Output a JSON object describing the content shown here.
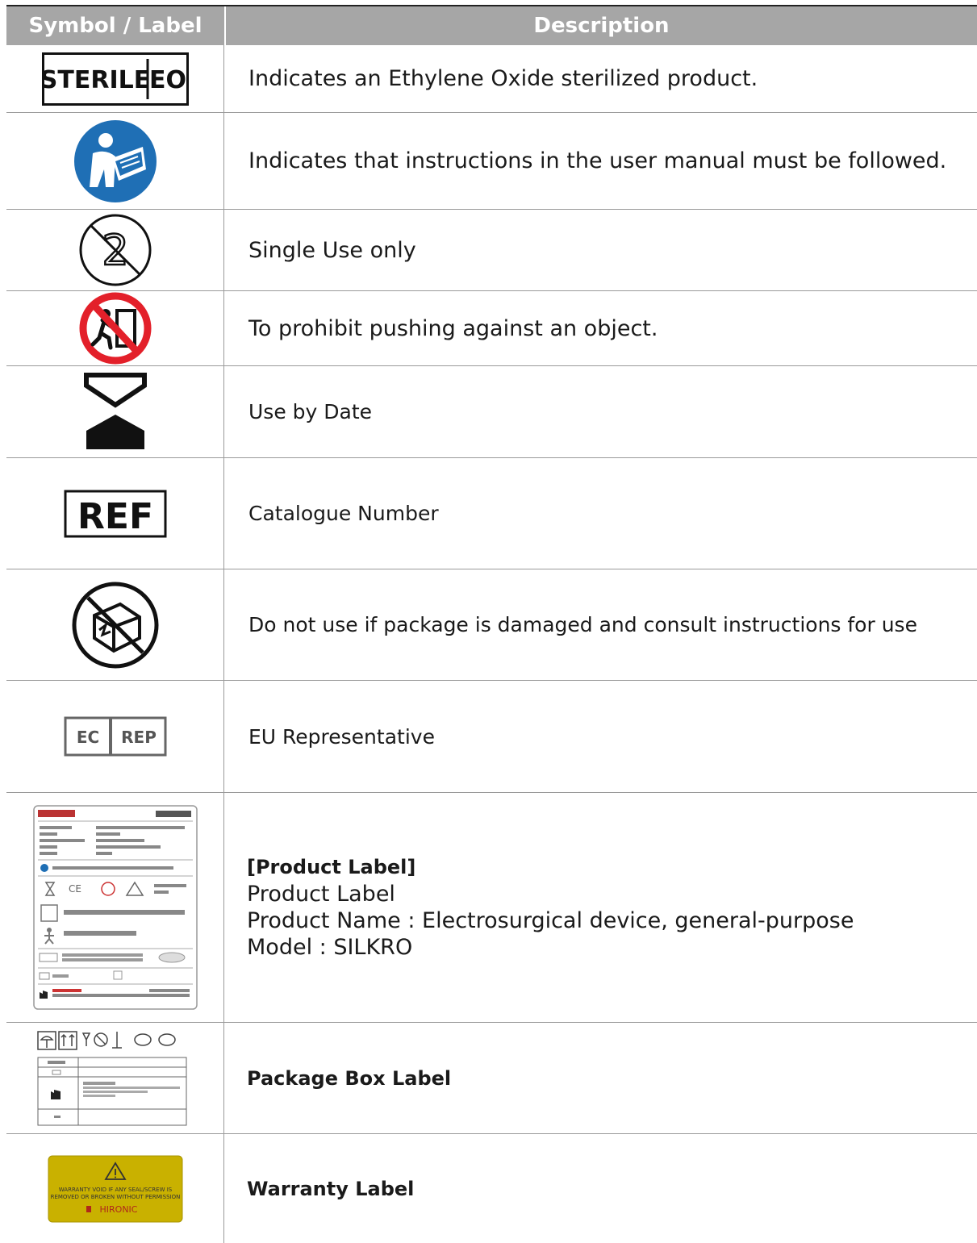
{
  "header": {
    "col1": "Symbol / Label",
    "col2": "Description"
  },
  "rows": [
    {
      "id": "sterile",
      "symbol": {
        "icon": "sterile-eo-icon",
        "text1": "STERILE",
        "text2": "EO"
      },
      "description": "Indicates an Ethylene Oxide sterilized product."
    },
    {
      "id": "manual",
      "symbol": {
        "icon": "read-manual-icon"
      },
      "description": "Indicates that instructions in the user manual must be followed."
    },
    {
      "id": "single",
      "symbol": {
        "icon": "single-use-icon",
        "text": "2"
      },
      "description": "Single Use only"
    },
    {
      "id": "push",
      "symbol": {
        "icon": "no-pushing-icon"
      },
      "description": "To prohibit pushing against an object."
    },
    {
      "id": "usebydate",
      "symbol": {
        "icon": "hourglass-icon"
      },
      "description": "Use by Date"
    },
    {
      "id": "ref",
      "symbol": {
        "icon": "ref-icon",
        "text": "REF"
      },
      "description": "Catalogue Number"
    },
    {
      "id": "damaged",
      "symbol": {
        "icon": "damaged-package-icon"
      },
      "description": "Do not use if package is damaged and consult instructions for use"
    },
    {
      "id": "ecrep",
      "symbol": {
        "icon": "ec-rep-icon",
        "text1": "EC",
        "text2": "REP"
      },
      "description": "EU Representative"
    },
    {
      "id": "product",
      "symbol": {
        "icon": "product-label-image"
      },
      "lines": [
        "[Product Label]",
        "Product Label",
        "Product Name : Electrosurgical device, general-purpose",
        "Model : SILKRO"
      ]
    },
    {
      "id": "package",
      "symbol": {
        "icon": "package-box-label-image"
      },
      "description": "Package Box Label"
    },
    {
      "id": "warranty",
      "symbol": {
        "icon": "warranty-label-image",
        "text1": "WARRANTY VOID IF ANY SEAL/SCREW IS",
        "text2": "REMOVED OR BROKEN WITHOUT PERMISSION",
        "brand": "HIRONIC"
      },
      "description": "Warranty Label"
    }
  ],
  "colors": {
    "header_bg": "#a6a6a6",
    "manual_blue": "#1f6fb5",
    "prohibit_red": "#e3202a",
    "warranty_yellow": "#c9b100"
  }
}
